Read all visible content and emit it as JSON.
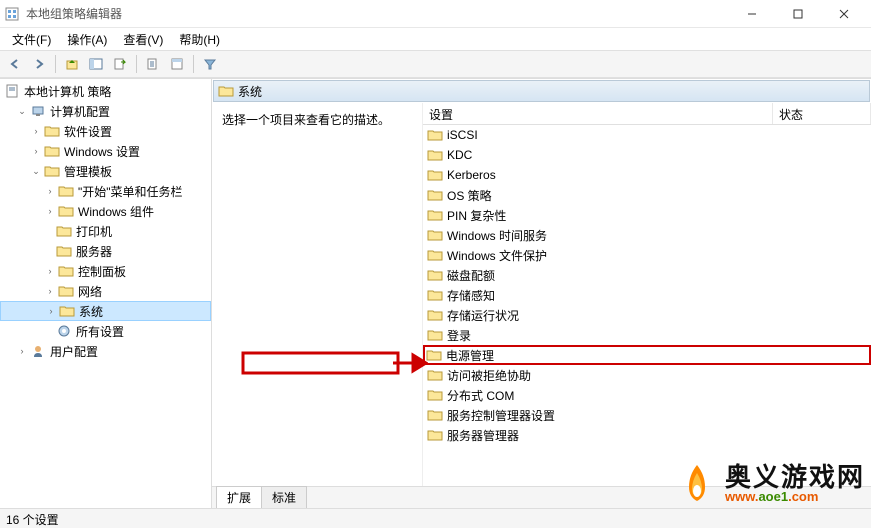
{
  "window": {
    "title": "本地组策略编辑器",
    "menu": [
      "文件(F)",
      "操作(A)",
      "查看(V)",
      "帮助(H)"
    ]
  },
  "tree": {
    "root": "本地计算机 策略",
    "computer_config": "计算机配置",
    "software_settings": "软件设置",
    "windows_settings": "Windows 设置",
    "admin_templates": "管理模板",
    "start_taskbar": "\"开始\"菜单和任务栏",
    "windows_components": "Windows 组件",
    "printers": "打印机",
    "server": "服务器",
    "control_panel": "控制面板",
    "network": "网络",
    "system": "系统",
    "all_settings": "所有设置",
    "user_config": "用户配置"
  },
  "content": {
    "path": "系统",
    "description": "选择一个项目来查看它的描述。",
    "columns": {
      "name": "设置",
      "state": "状态"
    },
    "items": [
      {
        "label": "iSCSI"
      },
      {
        "label": "KDC"
      },
      {
        "label": "Kerberos"
      },
      {
        "label": "OS 策略"
      },
      {
        "label": "PIN 复杂性"
      },
      {
        "label": "Windows 时间服务"
      },
      {
        "label": "Windows 文件保护"
      },
      {
        "label": "磁盘配额"
      },
      {
        "label": "存储感知"
      },
      {
        "label": "存储运行状况"
      },
      {
        "label": "登录"
      },
      {
        "label": "电源管理",
        "highlight": true
      },
      {
        "label": "访问被拒绝协助"
      },
      {
        "label": "分布式 COM"
      },
      {
        "label": "服务控制管理器设置"
      },
      {
        "label": "服务器管理器"
      }
    ],
    "tabs": [
      "扩展",
      "标准"
    ]
  },
  "status": "16 个设置",
  "watermark": {
    "main": "奥义游戏网",
    "sub_pre": "www.",
    "sub_mid": "aoe1",
    "sub_suf": ".com"
  }
}
